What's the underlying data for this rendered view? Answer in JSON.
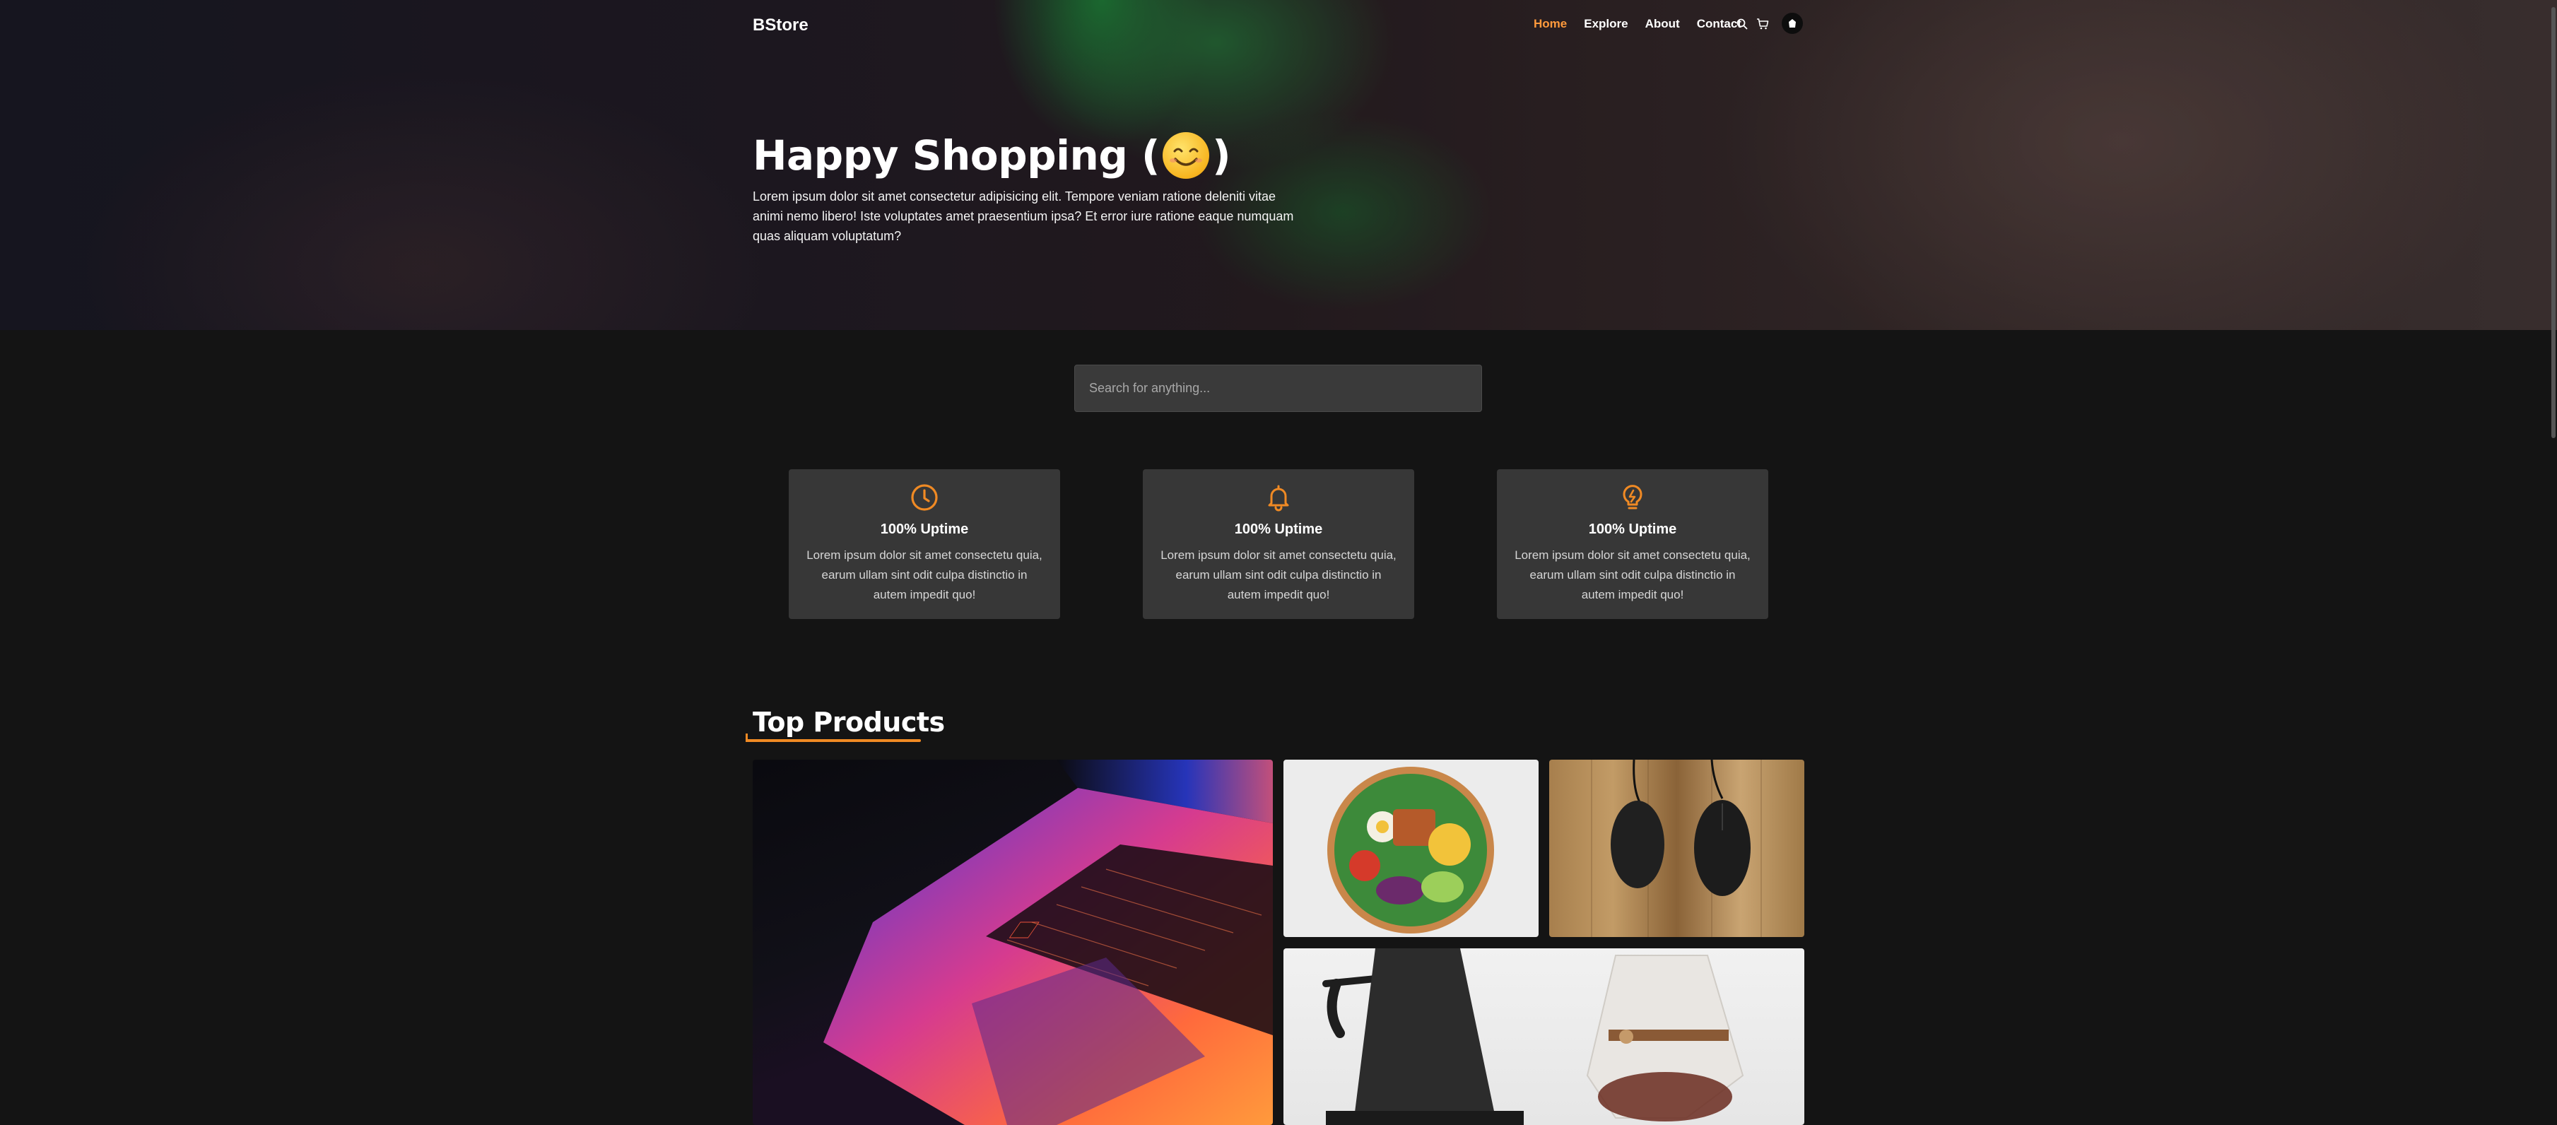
{
  "nav": {
    "brand": "BStore",
    "links": [
      {
        "label": "Home",
        "active": true
      },
      {
        "label": "Explore",
        "active": false
      },
      {
        "label": "About",
        "active": false
      },
      {
        "label": "Contact",
        "active": false
      }
    ],
    "icons": [
      "search-icon",
      "cart-icon",
      "user-avatar-icon"
    ]
  },
  "hero": {
    "title_prefix": "Happy Shopping (",
    "title_suffix": ")",
    "emoji": "smiling-face",
    "description": "Lorem ipsum dolor sit amet consectetur adipisicing elit. Tempore veniam ratione deleniti vitae animi nemo libero! Iste voluptates amet praesentium ipsa? Et error iure ratione eaque numquam quas aliquam voluptatum?"
  },
  "search": {
    "placeholder": "Search for anything..."
  },
  "features": [
    {
      "icon": "clock-icon",
      "title": "100% Uptime",
      "description": "Lorem ipsum dolor sit amet consectetu quia, earum ullam sint odit culpa distinctio in autem impedit quo!"
    },
    {
      "icon": "bell-icon",
      "title": "100% Uptime",
      "description": "Lorem ipsum dolor sit amet consectetu quia, earum ullam sint odit culpa distinctio in autem impedit quo!"
    },
    {
      "icon": "lightbulb-icon",
      "title": "100% Uptime",
      "description": "Lorem ipsum dolor sit amet consectetu quia, earum ullam sint odit culpa distinctio in autem impedit quo!"
    }
  ],
  "top_products": {
    "title": "Top Products",
    "items": [
      "laptop-image",
      "salad-image",
      "mouse-image",
      "kettle-coffee-image"
    ]
  },
  "colors": {
    "accent": "#ff9a3c",
    "background": "#141414",
    "card": "#373737"
  }
}
